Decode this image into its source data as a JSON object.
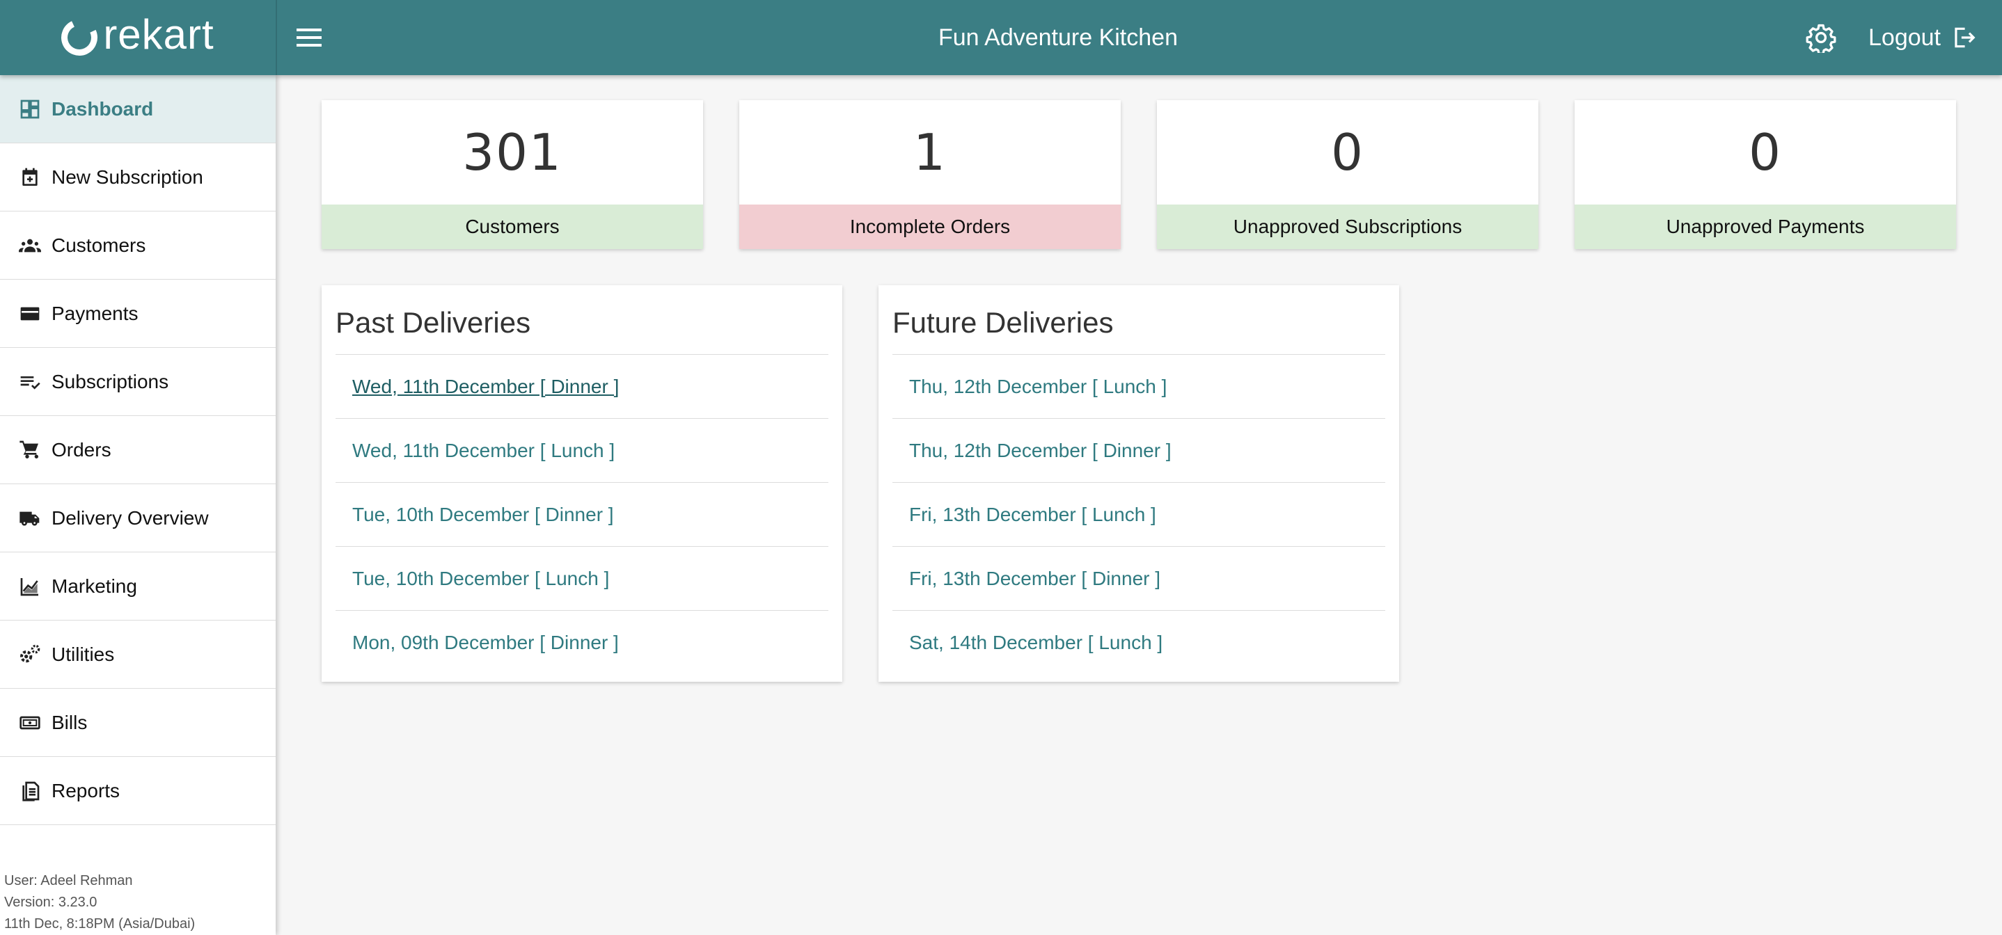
{
  "brand": {
    "name": "rekart"
  },
  "header": {
    "title": "Fun Adventure Kitchen",
    "logout_label": "Logout"
  },
  "sidebar": {
    "items": [
      {
        "label": "Dashboard",
        "icon": "dashboard-icon"
      },
      {
        "label": "New Subscription",
        "icon": "calendar-add-icon"
      },
      {
        "label": "Customers",
        "icon": "people-icon"
      },
      {
        "label": "Payments",
        "icon": "credit-card-icon"
      },
      {
        "label": "Subscriptions",
        "icon": "playlist-check-icon"
      },
      {
        "label": "Orders",
        "icon": "cart-icon"
      },
      {
        "label": "Delivery Overview",
        "icon": "truck-icon"
      },
      {
        "label": "Marketing",
        "icon": "chart-icon"
      },
      {
        "label": "Utilities",
        "icon": "gears-icon"
      },
      {
        "label": "Bills",
        "icon": "money-icon"
      },
      {
        "label": "Reports",
        "icon": "document-icon"
      }
    ],
    "footer": {
      "user": "User: Adeel Rehman",
      "version": "Version: 3.23.0",
      "datetime": "11th Dec, 8:18PM (Asia/Dubai)"
    }
  },
  "stats": [
    {
      "value": "301",
      "label": "Customers"
    },
    {
      "value": "1",
      "label": "Incomplete Orders"
    },
    {
      "value": "0",
      "label": "Unapproved Subscriptions"
    },
    {
      "value": "0",
      "label": "Unapproved Payments"
    }
  ],
  "past_deliveries": {
    "title": "Past Deliveries",
    "items": [
      "Wed, 11th December [ Dinner ]",
      "Wed, 11th December [ Lunch ]",
      "Tue, 10th December [ Dinner ]",
      "Tue, 10th December [ Lunch ]",
      "Mon, 09th December [ Dinner ]"
    ]
  },
  "future_deliveries": {
    "title": "Future Deliveries",
    "items": [
      "Thu, 12th December [ Lunch ]",
      "Thu, 12th December [ Dinner ]",
      "Fri, 13th December [ Lunch ]",
      "Fri, 13th December [ Dinner ]",
      "Sat, 14th December [ Lunch ]"
    ]
  },
  "colors": {
    "primary": "#3b7e84",
    "success_bg": "#d9ecd6",
    "warning_bg": "#f2cdd1",
    "link": "#2f7a80"
  }
}
